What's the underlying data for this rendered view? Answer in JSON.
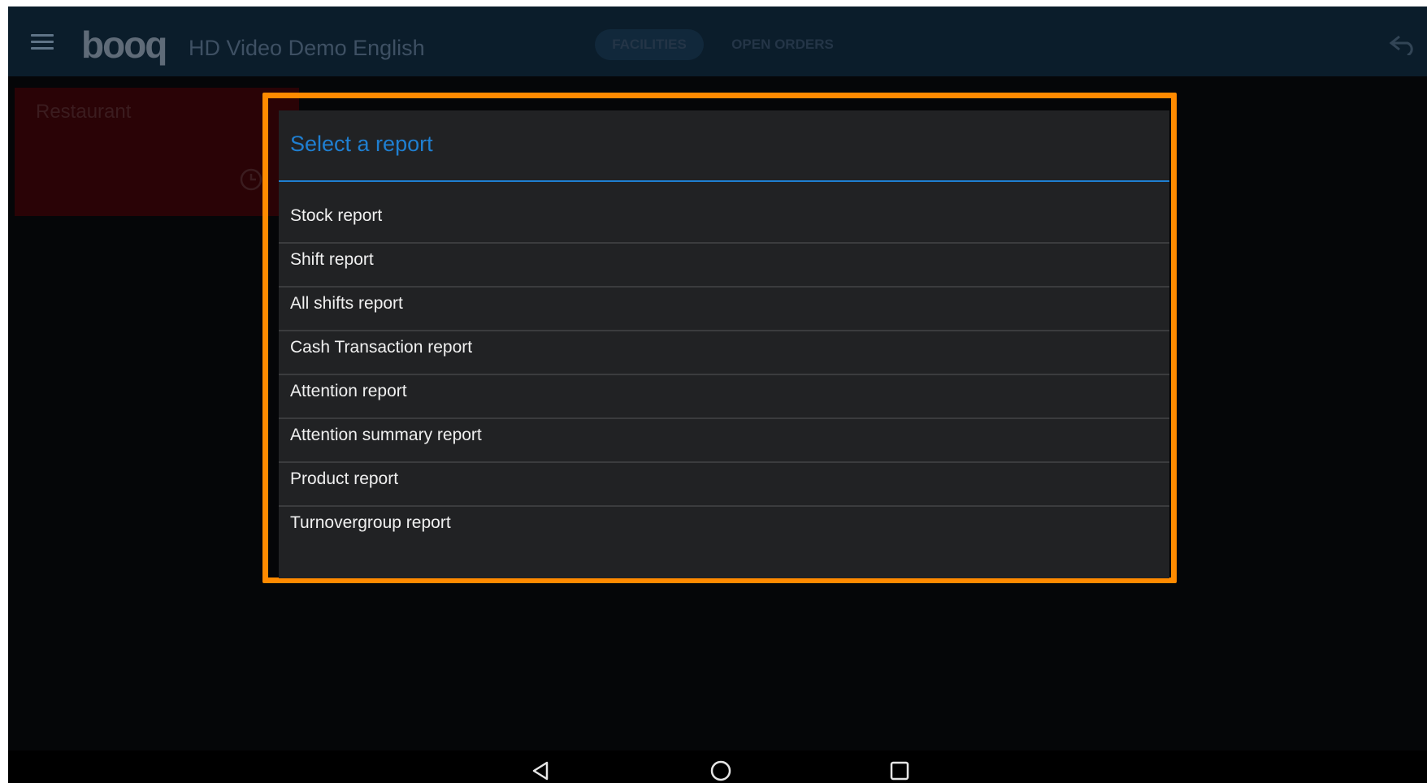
{
  "app": {
    "logo_text": "booq",
    "title": "HD Video Demo English",
    "tabs": [
      {
        "label": "FACILITIES"
      },
      {
        "label": "OPEN ORDERS"
      }
    ]
  },
  "background": {
    "card_label": "Restaurant"
  },
  "dialog": {
    "title": "Select a report",
    "items": [
      {
        "label": "Stock report"
      },
      {
        "label": "Shift report"
      },
      {
        "label": "All shifts report"
      },
      {
        "label": "Cash Transaction report"
      },
      {
        "label": "Attention report"
      },
      {
        "label": "Attention summary report"
      },
      {
        "label": "Product report"
      },
      {
        "label": "Turnovergroup report"
      }
    ]
  },
  "colors": {
    "highlight": "#ff8a00",
    "accent": "#1f7fd1",
    "dialog_bg": "#212224"
  },
  "icons": [
    "menu-icon",
    "back-arrow-icon",
    "clock-icon",
    "nav-back-icon",
    "nav-home-icon",
    "nav-recents-icon"
  ]
}
